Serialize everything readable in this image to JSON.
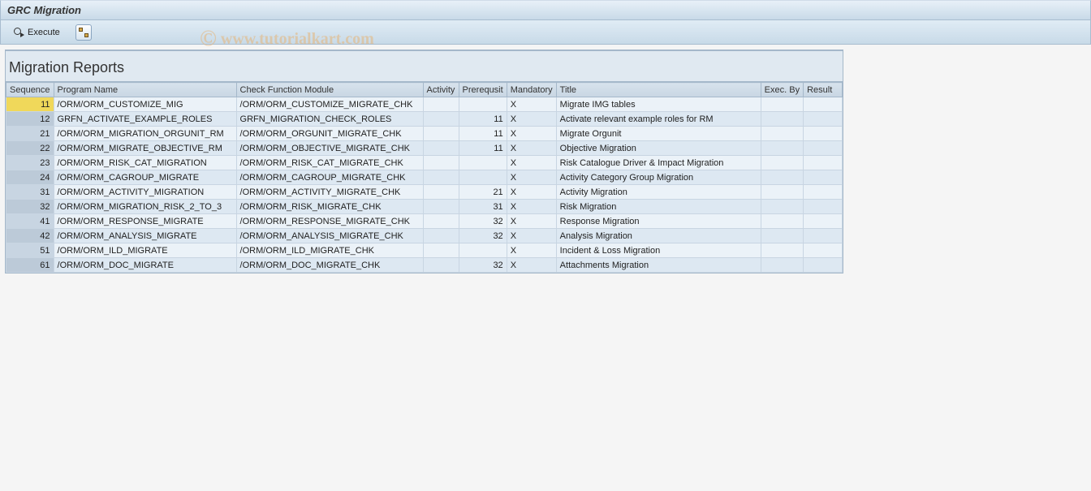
{
  "header": {
    "title": "GRC Migration"
  },
  "toolbar": {
    "execute_label": "Execute"
  },
  "section": {
    "title": "Migration Reports"
  },
  "columns": {
    "seq": "Sequence",
    "prog": "Program Name",
    "check": "Check Function Module",
    "activity": "Activity",
    "prereq": "Prerequsit",
    "mandatory": "Mandatory",
    "title": "Title",
    "exec_by": "Exec. By",
    "result": "Result"
  },
  "rows": [
    {
      "seq": "11",
      "prog": "/ORM/ORM_CUSTOMIZE_MIG",
      "check": "/ORM/ORM_CUSTOMIZE_MIGRATE_CHK",
      "activity": "",
      "prereq": "",
      "mandatory": "X",
      "title": "Migrate IMG tables",
      "exec_by": "",
      "result": ""
    },
    {
      "seq": "12",
      "prog": "GRFN_ACTIVATE_EXAMPLE_ROLES",
      "check": "GRFN_MIGRATION_CHECK_ROLES",
      "activity": "",
      "prereq": "11",
      "mandatory": "X",
      "title": "Activate relevant example roles for RM",
      "exec_by": "",
      "result": ""
    },
    {
      "seq": "21",
      "prog": "/ORM/ORM_MIGRATION_ORGUNIT_RM",
      "check": "/ORM/ORM_ORGUNIT_MIGRATE_CHK",
      "activity": "",
      "prereq": "11",
      "mandatory": "X",
      "title": "Migrate Orgunit",
      "exec_by": "",
      "result": ""
    },
    {
      "seq": "22",
      "prog": "/ORM/ORM_MIGRATE_OBJECTIVE_RM",
      "check": "/ORM/ORM_OBJECTIVE_MIGRATE_CHK",
      "activity": "",
      "prereq": "11",
      "mandatory": "X",
      "title": "Objective Migration",
      "exec_by": "",
      "result": ""
    },
    {
      "seq": "23",
      "prog": "/ORM/ORM_RISK_CAT_MIGRATION",
      "check": "/ORM/ORM_RISK_CAT_MIGRATE_CHK",
      "activity": "",
      "prereq": "",
      "mandatory": "X",
      "title": "Risk Catalogue Driver & Impact Migration",
      "exec_by": "",
      "result": ""
    },
    {
      "seq": "24",
      "prog": "/ORM/ORM_CAGROUP_MIGRATE",
      "check": "/ORM/ORM_CAGROUP_MIGRATE_CHK",
      "activity": "",
      "prereq": "",
      "mandatory": "X",
      "title": "Activity Category Group Migration",
      "exec_by": "",
      "result": ""
    },
    {
      "seq": "31",
      "prog": "/ORM/ORM_ACTIVITY_MIGRATION",
      "check": "/ORM/ORM_ACTIVITY_MIGRATE_CHK",
      "activity": "",
      "prereq": "21",
      "mandatory": "X",
      "title": "Activity Migration",
      "exec_by": "",
      "result": ""
    },
    {
      "seq": "32",
      "prog": "/ORM/ORM_MIGRATION_RISK_2_TO_3",
      "check": "/ORM/ORM_RISK_MIGRATE_CHK",
      "activity": "",
      "prereq": "31",
      "mandatory": "X",
      "title": "Risk Migration",
      "exec_by": "",
      "result": ""
    },
    {
      "seq": "41",
      "prog": "/ORM/ORM_RESPONSE_MIGRATE",
      "check": "/ORM/ORM_RESPONSE_MIGRATE_CHK",
      "activity": "",
      "prereq": "32",
      "mandatory": "X",
      "title": "Response Migration",
      "exec_by": "",
      "result": ""
    },
    {
      "seq": "42",
      "prog": "/ORM/ORM_ANALYSIS_MIGRATE",
      "check": "/ORM/ORM_ANALYSIS_MIGRATE_CHK",
      "activity": "",
      "prereq": "32",
      "mandatory": "X",
      "title": "Analysis Migration",
      "exec_by": "",
      "result": ""
    },
    {
      "seq": "51",
      "prog": "/ORM/ORM_ILD_MIGRATE",
      "check": "/ORM/ORM_ILD_MIGRATE_CHK",
      "activity": "",
      "prereq": "",
      "mandatory": "X",
      "title": "Incident & Loss Migration",
      "exec_by": "",
      "result": ""
    },
    {
      "seq": "61",
      "prog": "/ORM/ORM_DOC_MIGRATE",
      "check": "/ORM/ORM_DOC_MIGRATE_CHK",
      "activity": "",
      "prereq": "32",
      "mandatory": "X",
      "title": "Attachments Migration",
      "exec_by": "",
      "result": ""
    }
  ],
  "watermark": "www.tutorialkart.com"
}
